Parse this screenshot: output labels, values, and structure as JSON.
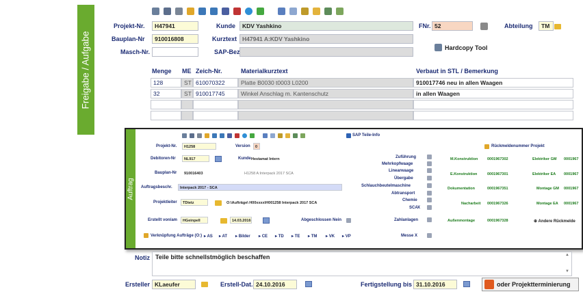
{
  "sidebar": {
    "title": "Freigabe / Aufgabe"
  },
  "toolbar": {
    "icons": [
      "printer-icon",
      "table-icon",
      "list-icon",
      "pencil-icon",
      "truck-icon",
      "truck-icon",
      "truck-icon",
      "question-icon",
      "globe-icon",
      "arrow-icon",
      "document-icon",
      "document-icon",
      "grid-icon",
      "folder-icon",
      "copy-icon",
      "export-icon"
    ]
  },
  "header": {
    "projekt_label": "Projekt-Nr.",
    "projekt_value": "H47941",
    "kunde_label": "Kunde",
    "kunde_value": "KDV Yashkino",
    "fnr_label": "FNr.",
    "fnr_value": "52",
    "abteilung_label": "Abteilung",
    "abteilung_value": "TM",
    "bauplan_label": "Bauplan-Nr",
    "bauplan_value": "910016808",
    "kurztext_label": "Kurztext",
    "kurztext_value": "H47941 A:KDV Yashkino",
    "masch_label": "Masch-Nr.",
    "masch_value": "",
    "sap_label": "SAP-Bez.",
    "sap_value": "",
    "hardcopy_label": "Hardcopy Tool"
  },
  "table": {
    "headers": {
      "menge": "Menge",
      "me": "ME",
      "zeich": "Zeich-Nr.",
      "material": "Materialkurztext",
      "verbaut": "Verbaut in STL / Bemerkung"
    },
    "rows": [
      {
        "menge": "128",
        "me": "ST",
        "zeich": "610070322",
        "material": "Platte B0030 t0003 L0200",
        "verbaut": "910017746 neu in allen Waagen"
      },
      {
        "menge": "32",
        "me": "ST",
        "zeich": "910017745",
        "material": "Winkel Anschlag m. Kantenschutz",
        "verbaut": "in allen Waagen"
      }
    ]
  },
  "dialog": {
    "sidebar_title": "Auftrag",
    "sap_teile_info": "SAP Teile-Info",
    "projekt_label": "Projekt-Nr.",
    "projekt_value": "H1258",
    "version_label": "Version",
    "version_value": "0",
    "rueckmelde_label": "Rückmeldenummer Projekt",
    "debitoren_label": "Debitoren-Nr",
    "debitoren_value": "NL917",
    "kunde_label": "Kunde",
    "kunde_value": "Hestamat Intern",
    "bauplan_label": "Bauplan-Nr",
    "bauplan_value": "910016403",
    "bauplan_text": "H1258 A:Interpack 2017 SCA",
    "auftrags_label": "Auftragsbeschr.",
    "auftrags_value": "Interpack 2017 - SCA",
    "projektleiter_label": "Projektleiter",
    "projektleiter_value": "TDietz",
    "pfad_value": "O:\\Aufträge\\ H00xxxx\\H001258 Interpack 2017 SCA",
    "erstellt_label": "Erstellt von/am",
    "erstellt_value": "HGeinpell",
    "erstellt_date": "14.03.2016",
    "abgeschlossen_label": "Abgeschlossen",
    "abgeschlossen_value": "Nein",
    "verknuepfung_label": "Verknüpfung Aufträge (O:)",
    "links": [
      "AS",
      "AT",
      "Bilder",
      "CE",
      "TD",
      "TE",
      "TM",
      "VK",
      "VP"
    ],
    "checks": [
      "Zuführung",
      "Mehrkopfwaage",
      "Linearwaage",
      "Übergabe",
      "Schlauchbeutelmaschine",
      "Abtransport",
      "Chemie",
      "SCA",
      "Zahlanlagen"
    ],
    "messe_label": "Messe",
    "messe_value": "X",
    "sca_value": "X",
    "r_labels": [
      "M.Konstruktion",
      "E.Konstruktion",
      "Dokumentation",
      "Nacharbeit",
      "Außenmontage"
    ],
    "r_values": [
      "0001967302",
      "0001967301",
      "0001967351",
      "0001967326",
      "0001967328"
    ],
    "r2_labels": [
      "Elektriker GM",
      "Elektriker EA",
      "Montage GM",
      "Montage EA"
    ],
    "r2_values": [
      "0001967",
      "0001967",
      "0001967",
      "0001967"
    ],
    "andere_label": "Andere Rückmelde"
  },
  "notiz": {
    "label": "Notiz",
    "value": "Teile bitte schnellstmöglich beschaffen"
  },
  "footer": {
    "ersteller_label": "Ersteller",
    "ersteller_value": "KLaeufer",
    "erstell_dat_label": "Erstell-Dat.",
    "erstell_dat_value": "24.10.2016",
    "fertigstellung_label": "Fertigstellung bis",
    "fertigstellung_value": "31.10.2016",
    "projektterminierung_label": "oder Projektterminierung"
  },
  "colors": {
    "accent_green": "#6aab2f",
    "label_blue": "#1c2c74",
    "field_yellow": "#fcfbd7",
    "field_green": "#dde8dd",
    "field_gray": "#dcdcdc"
  }
}
